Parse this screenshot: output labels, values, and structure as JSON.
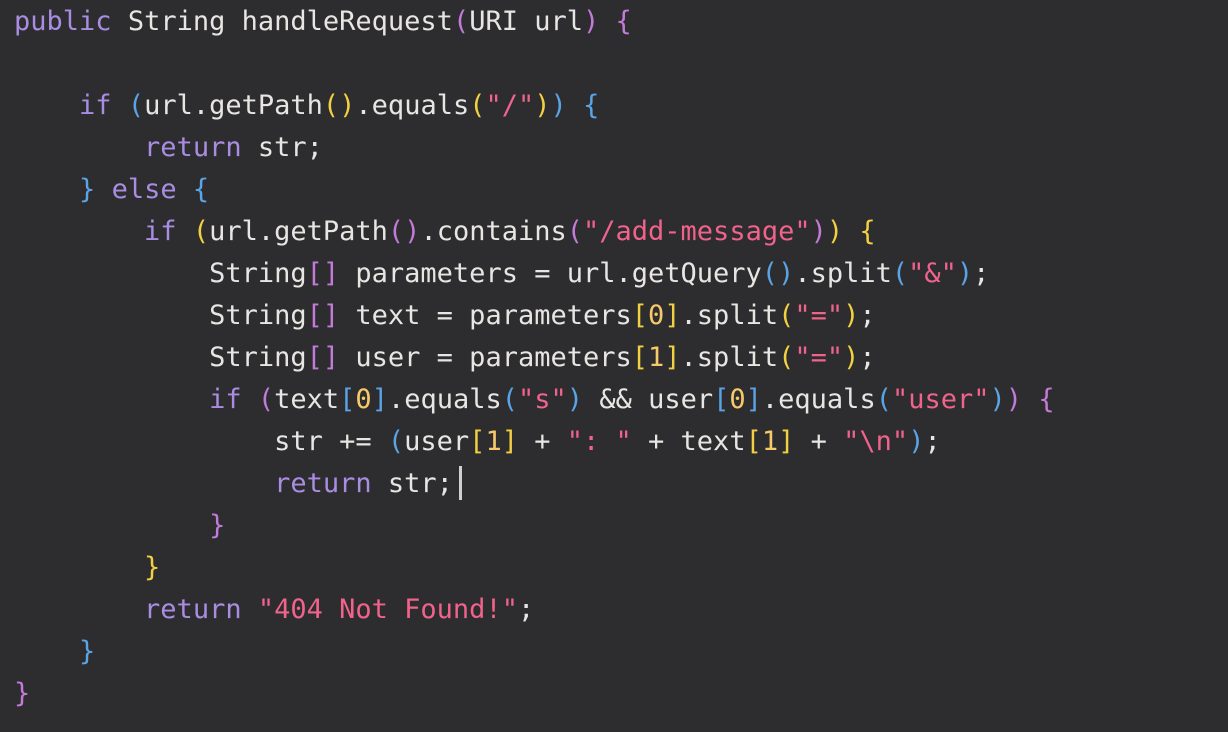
{
  "editor": {
    "lines": [
      [
        [
          "kw",
          "public"
        ],
        [
          "id",
          " "
        ],
        [
          "ty",
          "String"
        ],
        [
          "id",
          " handleRequest"
        ],
        [
          "p1",
          "("
        ],
        [
          "ty",
          "URI"
        ],
        [
          "id",
          " url"
        ],
        [
          "p1",
          ")"
        ],
        [
          "id",
          " "
        ],
        [
          "p1",
          "{"
        ]
      ],
      [],
      [
        [
          "id",
          "    "
        ],
        [
          "kw",
          "if"
        ],
        [
          "id",
          " "
        ],
        [
          "p2",
          "("
        ],
        [
          "id",
          "url.getPath"
        ],
        [
          "p3",
          "("
        ],
        [
          "p3",
          ")"
        ],
        [
          "id",
          ".equals"
        ],
        [
          "p3",
          "("
        ],
        [
          "str",
          "\"/\""
        ],
        [
          "p3",
          ")"
        ],
        [
          "p2",
          ")"
        ],
        [
          "id",
          " "
        ],
        [
          "p2",
          "{"
        ]
      ],
      [
        [
          "id",
          "        "
        ],
        [
          "kw",
          "return"
        ],
        [
          "id",
          " str;"
        ]
      ],
      [
        [
          "id",
          "    "
        ],
        [
          "p2",
          "}"
        ],
        [
          "id",
          " "
        ],
        [
          "kw",
          "else"
        ],
        [
          "id",
          " "
        ],
        [
          "p2",
          "{"
        ]
      ],
      [
        [
          "id",
          "        "
        ],
        [
          "kw",
          "if"
        ],
        [
          "id",
          " "
        ],
        [
          "p3",
          "("
        ],
        [
          "id",
          "url.getPath"
        ],
        [
          "p1",
          "("
        ],
        [
          "p1",
          ")"
        ],
        [
          "id",
          ".contains"
        ],
        [
          "p1",
          "("
        ],
        [
          "str",
          "\"/add-message\""
        ],
        [
          "p1",
          ")"
        ],
        [
          "p3",
          ")"
        ],
        [
          "id",
          " "
        ],
        [
          "p3",
          "{"
        ]
      ],
      [
        [
          "id",
          "            "
        ],
        [
          "ty",
          "String"
        ],
        [
          "p1",
          "[]"
        ],
        [
          "id",
          " parameters = url.getQuery"
        ],
        [
          "p2",
          "("
        ],
        [
          "p2",
          ")"
        ],
        [
          "id",
          ".split"
        ],
        [
          "p2",
          "("
        ],
        [
          "str",
          "\"&\""
        ],
        [
          "p2",
          ")"
        ],
        [
          "id",
          ";"
        ]
      ],
      [
        [
          "id",
          "            "
        ],
        [
          "ty",
          "String"
        ],
        [
          "p1",
          "[]"
        ],
        [
          "id",
          " text = parameters"
        ],
        [
          "p3",
          "["
        ],
        [
          "num",
          "0"
        ],
        [
          "p3",
          "]"
        ],
        [
          "id",
          ".split"
        ],
        [
          "p3",
          "("
        ],
        [
          "str",
          "\"=\""
        ],
        [
          "p3",
          ")"
        ],
        [
          "id",
          ";"
        ]
      ],
      [
        [
          "id",
          "            "
        ],
        [
          "ty",
          "String"
        ],
        [
          "p1",
          "[]"
        ],
        [
          "id",
          " user = parameters"
        ],
        [
          "p3",
          "["
        ],
        [
          "num",
          "1"
        ],
        [
          "p3",
          "]"
        ],
        [
          "id",
          ".split"
        ],
        [
          "p3",
          "("
        ],
        [
          "str",
          "\"=\""
        ],
        [
          "p3",
          ")"
        ],
        [
          "id",
          ";"
        ]
      ],
      [
        [
          "id",
          "            "
        ],
        [
          "kw",
          "if"
        ],
        [
          "id",
          " "
        ],
        [
          "p1",
          "("
        ],
        [
          "id",
          "text"
        ],
        [
          "p2",
          "["
        ],
        [
          "num",
          "0"
        ],
        [
          "p2",
          "]"
        ],
        [
          "id",
          ".equals"
        ],
        [
          "p2",
          "("
        ],
        [
          "str",
          "\"s\""
        ],
        [
          "p2",
          ")"
        ],
        [
          "id",
          " && user"
        ],
        [
          "p2",
          "["
        ],
        [
          "num",
          "0"
        ],
        [
          "p2",
          "]"
        ],
        [
          "id",
          ".equals"
        ],
        [
          "p2",
          "("
        ],
        [
          "str",
          "\"user\""
        ],
        [
          "p2",
          ")"
        ],
        [
          "p1",
          ")"
        ],
        [
          "id",
          " "
        ],
        [
          "p1",
          "{"
        ]
      ],
      [
        [
          "id",
          "                str += "
        ],
        [
          "p2",
          "("
        ],
        [
          "id",
          "user"
        ],
        [
          "p3",
          "["
        ],
        [
          "num",
          "1"
        ],
        [
          "p3",
          "]"
        ],
        [
          "id",
          " + "
        ],
        [
          "str",
          "\": \""
        ],
        [
          "id",
          " + text"
        ],
        [
          "p3",
          "["
        ],
        [
          "num",
          "1"
        ],
        [
          "p3",
          "]"
        ],
        [
          "id",
          " + "
        ],
        [
          "str",
          "\"\\n\""
        ],
        [
          "p2",
          ")"
        ],
        [
          "id",
          ";"
        ]
      ],
      [
        [
          "id",
          "                "
        ],
        [
          "kw",
          "return"
        ],
        [
          "id",
          " str;"
        ],
        [
          "caret",
          ""
        ]
      ],
      [
        [
          "id",
          "            "
        ],
        [
          "p1",
          "}"
        ]
      ],
      [
        [
          "id",
          "        "
        ],
        [
          "p3",
          "}"
        ]
      ],
      [
        [
          "id",
          "        "
        ],
        [
          "kw",
          "return"
        ],
        [
          "id",
          " "
        ],
        [
          "str",
          "\"404 Not Found!\""
        ],
        [
          "id",
          ";"
        ]
      ],
      [
        [
          "id",
          "    "
        ],
        [
          "p2",
          "}"
        ]
      ],
      [
        [
          "p1",
          "}"
        ]
      ]
    ]
  }
}
